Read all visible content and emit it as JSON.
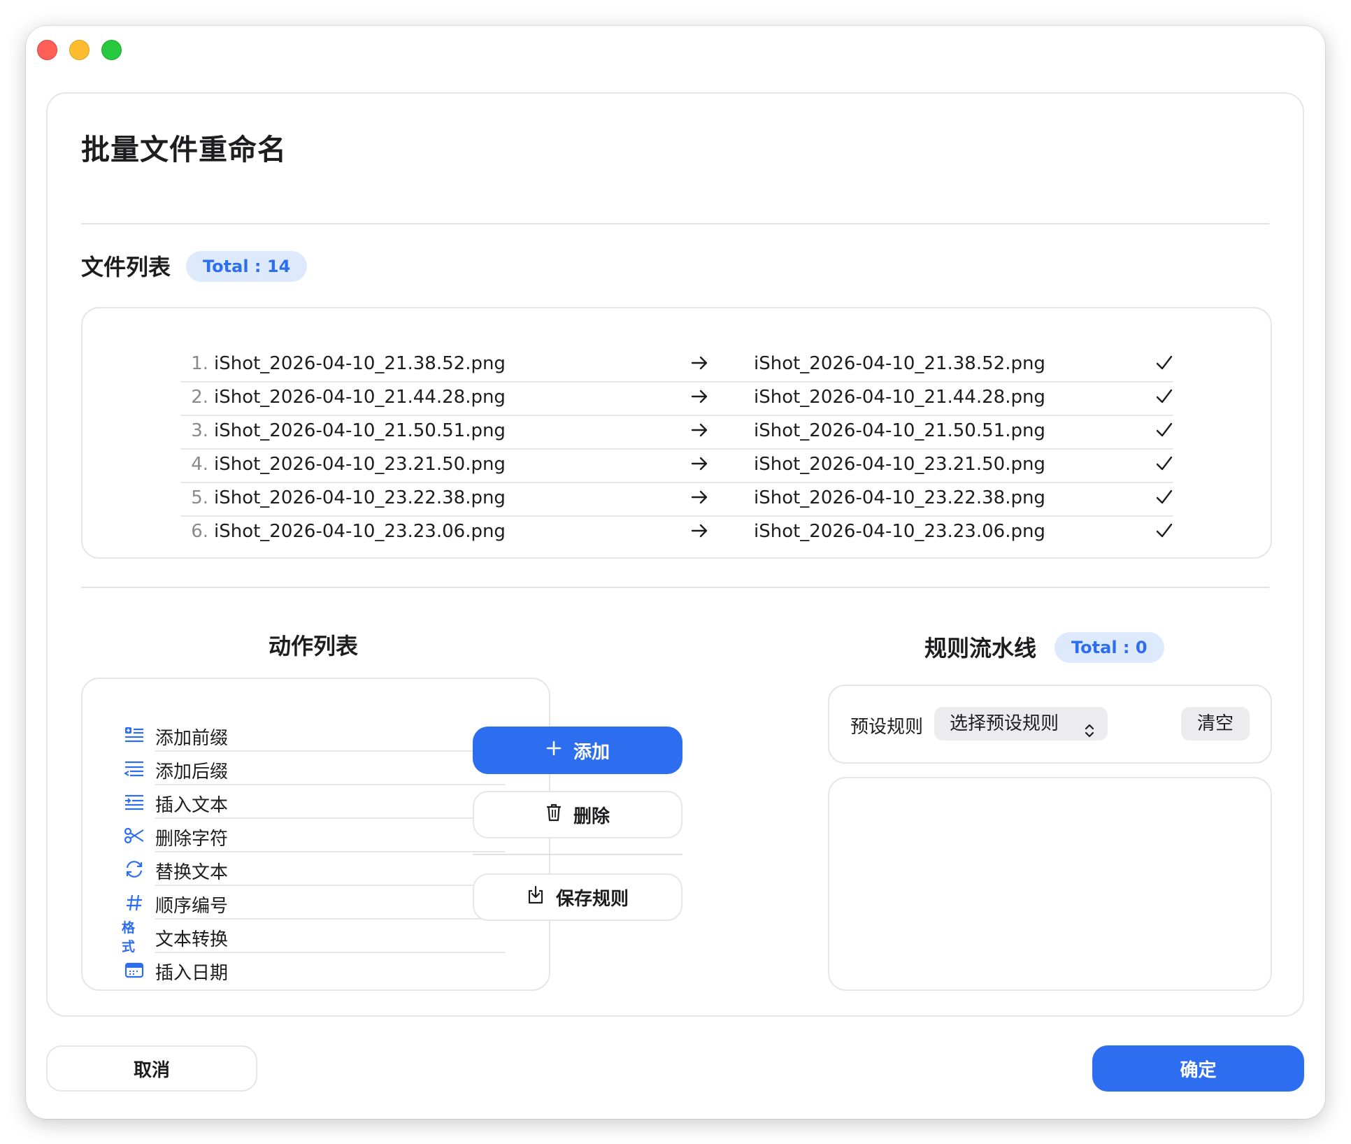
{
  "window": {
    "title": "批量文件重命名"
  },
  "file_list": {
    "title": "文件列表",
    "badge": "Total : 14",
    "rows": [
      {
        "num": "1.",
        "original": "iShot_2026-04-10_21.38.52.png",
        "renamed": "iShot_2026-04-10_21.38.52.png"
      },
      {
        "num": "2.",
        "original": "iShot_2026-04-10_21.44.28.png",
        "renamed": "iShot_2026-04-10_21.44.28.png"
      },
      {
        "num": "3.",
        "original": "iShot_2026-04-10_21.50.51.png",
        "renamed": "iShot_2026-04-10_21.50.51.png"
      },
      {
        "num": "4.",
        "original": "iShot_2026-04-10_23.21.50.png",
        "renamed": "iShot_2026-04-10_23.21.50.png"
      },
      {
        "num": "5.",
        "original": "iShot_2026-04-10_23.22.38.png",
        "renamed": "iShot_2026-04-10_23.22.38.png"
      },
      {
        "num": "6.",
        "original": "iShot_2026-04-10_23.23.06.png",
        "renamed": "iShot_2026-04-10_23.23.06.png"
      }
    ]
  },
  "actions": {
    "title": "动作列表",
    "items": [
      {
        "label": "添加前缀",
        "icon": "prefix-icon"
      },
      {
        "label": "添加后缀",
        "icon": "suffix-icon"
      },
      {
        "label": "插入文本",
        "icon": "insert-text-icon"
      },
      {
        "label": "删除字符",
        "icon": "scissors-icon"
      },
      {
        "label": "替换文本",
        "icon": "replace-icon"
      },
      {
        "label": "顺序编号",
        "icon": "hash-icon"
      },
      {
        "label": "文本转换",
        "icon": "format-icon",
        "icon_text": "格式"
      },
      {
        "label": "插入日期",
        "icon": "calendar-icon"
      }
    ]
  },
  "buttons": {
    "add": "添加",
    "delete": "删除",
    "save_rule": "保存规则"
  },
  "pipeline": {
    "title": "规则流水线",
    "badge": "Total : 0",
    "preset_label": "预设规则",
    "preset_select": "选择预设规则",
    "clear": "清空"
  },
  "footer": {
    "cancel": "取消",
    "confirm": "确定"
  },
  "colors": {
    "accent": "#2d6ef0",
    "badge_bg": "#dde9fd"
  }
}
